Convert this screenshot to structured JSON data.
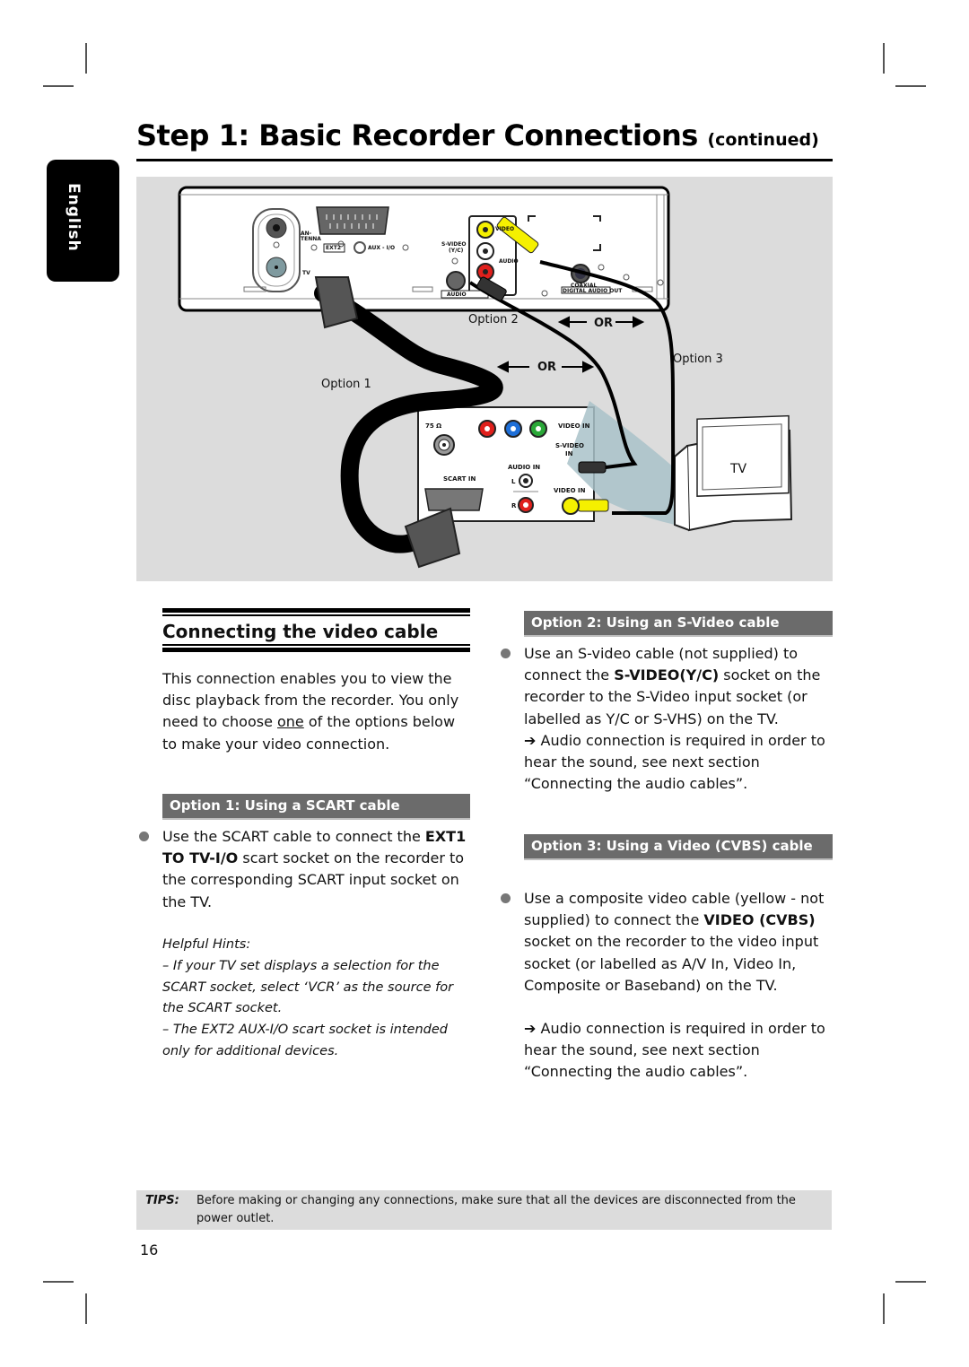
{
  "page": {
    "title_main": "Step 1: Basic Recorder Connections",
    "title_suffix": "(continued)",
    "language_tab": "English",
    "page_number": "16"
  },
  "diagram": {
    "labels": {
      "option1": "Option 1",
      "option2": "Option 2",
      "option3": "Option 3",
      "or_upper": "OR",
      "or_lower": "OR",
      "tv": "TV"
    },
    "recorder_panel": {
      "antenna": "AN-TENNA",
      "tv_out": "TV",
      "ext2": "EXT2",
      "aux_io": "AUX - I/O",
      "s_video": "S-VIDEO",
      "yc": "(Y/C)",
      "video": "VIDEO",
      "audio": "AUDIO",
      "audio_label": "AUDIO",
      "coaxial": "COAXIAL",
      "digital_audio_out": "DIGITAL AUDIO OUT"
    },
    "tv_panel": {
      "ohm": "75 Ω",
      "video_in_top": "VIDEO IN",
      "s_video_in_1": "S-VIDEO",
      "s_video_in_2": "IN",
      "audio_in": "AUDIO IN",
      "scart_in": "SCART IN",
      "audio_l": "L",
      "audio_r": "R",
      "video_in_bottom": "VIDEO IN"
    },
    "colors": {
      "background": "#dcdcdc",
      "yellow_plug": "#f5f000",
      "red_socket": "#e0201c",
      "blue_socket": "#1e6fd8",
      "green_socket": "#2aa838",
      "tv_beam": "#a9c2c9"
    }
  },
  "left_column": {
    "section_heading": "Connecting the video cable",
    "intro_before": "This connection enables you to view the disc playback from the recorder. You only need to choose ",
    "intro_underlined": "one",
    "intro_after": " of the options below to make your video connection.",
    "option1": {
      "heading": "Option 1: Using a SCART cable",
      "bullet_before": "Use the SCART cable to connect the ",
      "bullet_bold": "EXT1 TO TV-I/O",
      "bullet_after": " scart socket on the recorder to the corresponding SCART input socket on the TV.",
      "hints_title": "Helpful Hints:",
      "hint1": "–  If your TV set displays a selection for the SCART socket, select ‘VCR’ as the source for the SCART socket.",
      "hint2": "–  The EXT2 AUX-I/O scart socket is intended only for additional devices."
    }
  },
  "right_column": {
    "option2": {
      "heading": "Option 2: Using an S-Video cable",
      "bullet_before": "Use an S-video cable (not supplied) to connect the ",
      "bullet_bold": "S-VIDEO(Y/C)",
      "bullet_after": " socket on the recorder to the S-Video input socket (or labelled as Y/C or S-VHS) on the TV.",
      "note": "➔  Audio connection is required in order to hear the sound, see next section “Connecting the audio cables”."
    },
    "option3": {
      "heading": "Option 3: Using a Video (CVBS) cable",
      "bullet_before": "Use a composite video cable (yellow - not supplied) to connect the ",
      "bullet_bold": "VIDEO (CVBS)",
      "bullet_after": " socket on the recorder to the video input socket (or labelled as A/V In, Video In, Composite or Baseband) on the TV.",
      "note": "➔  Audio connection is required in order to hear the sound, see next section “Connecting the audio cables”."
    }
  },
  "tips": {
    "label": "TIPS:",
    "text": "Before making or changing any connections, make sure that all the devices are disconnected from the power outlet."
  }
}
